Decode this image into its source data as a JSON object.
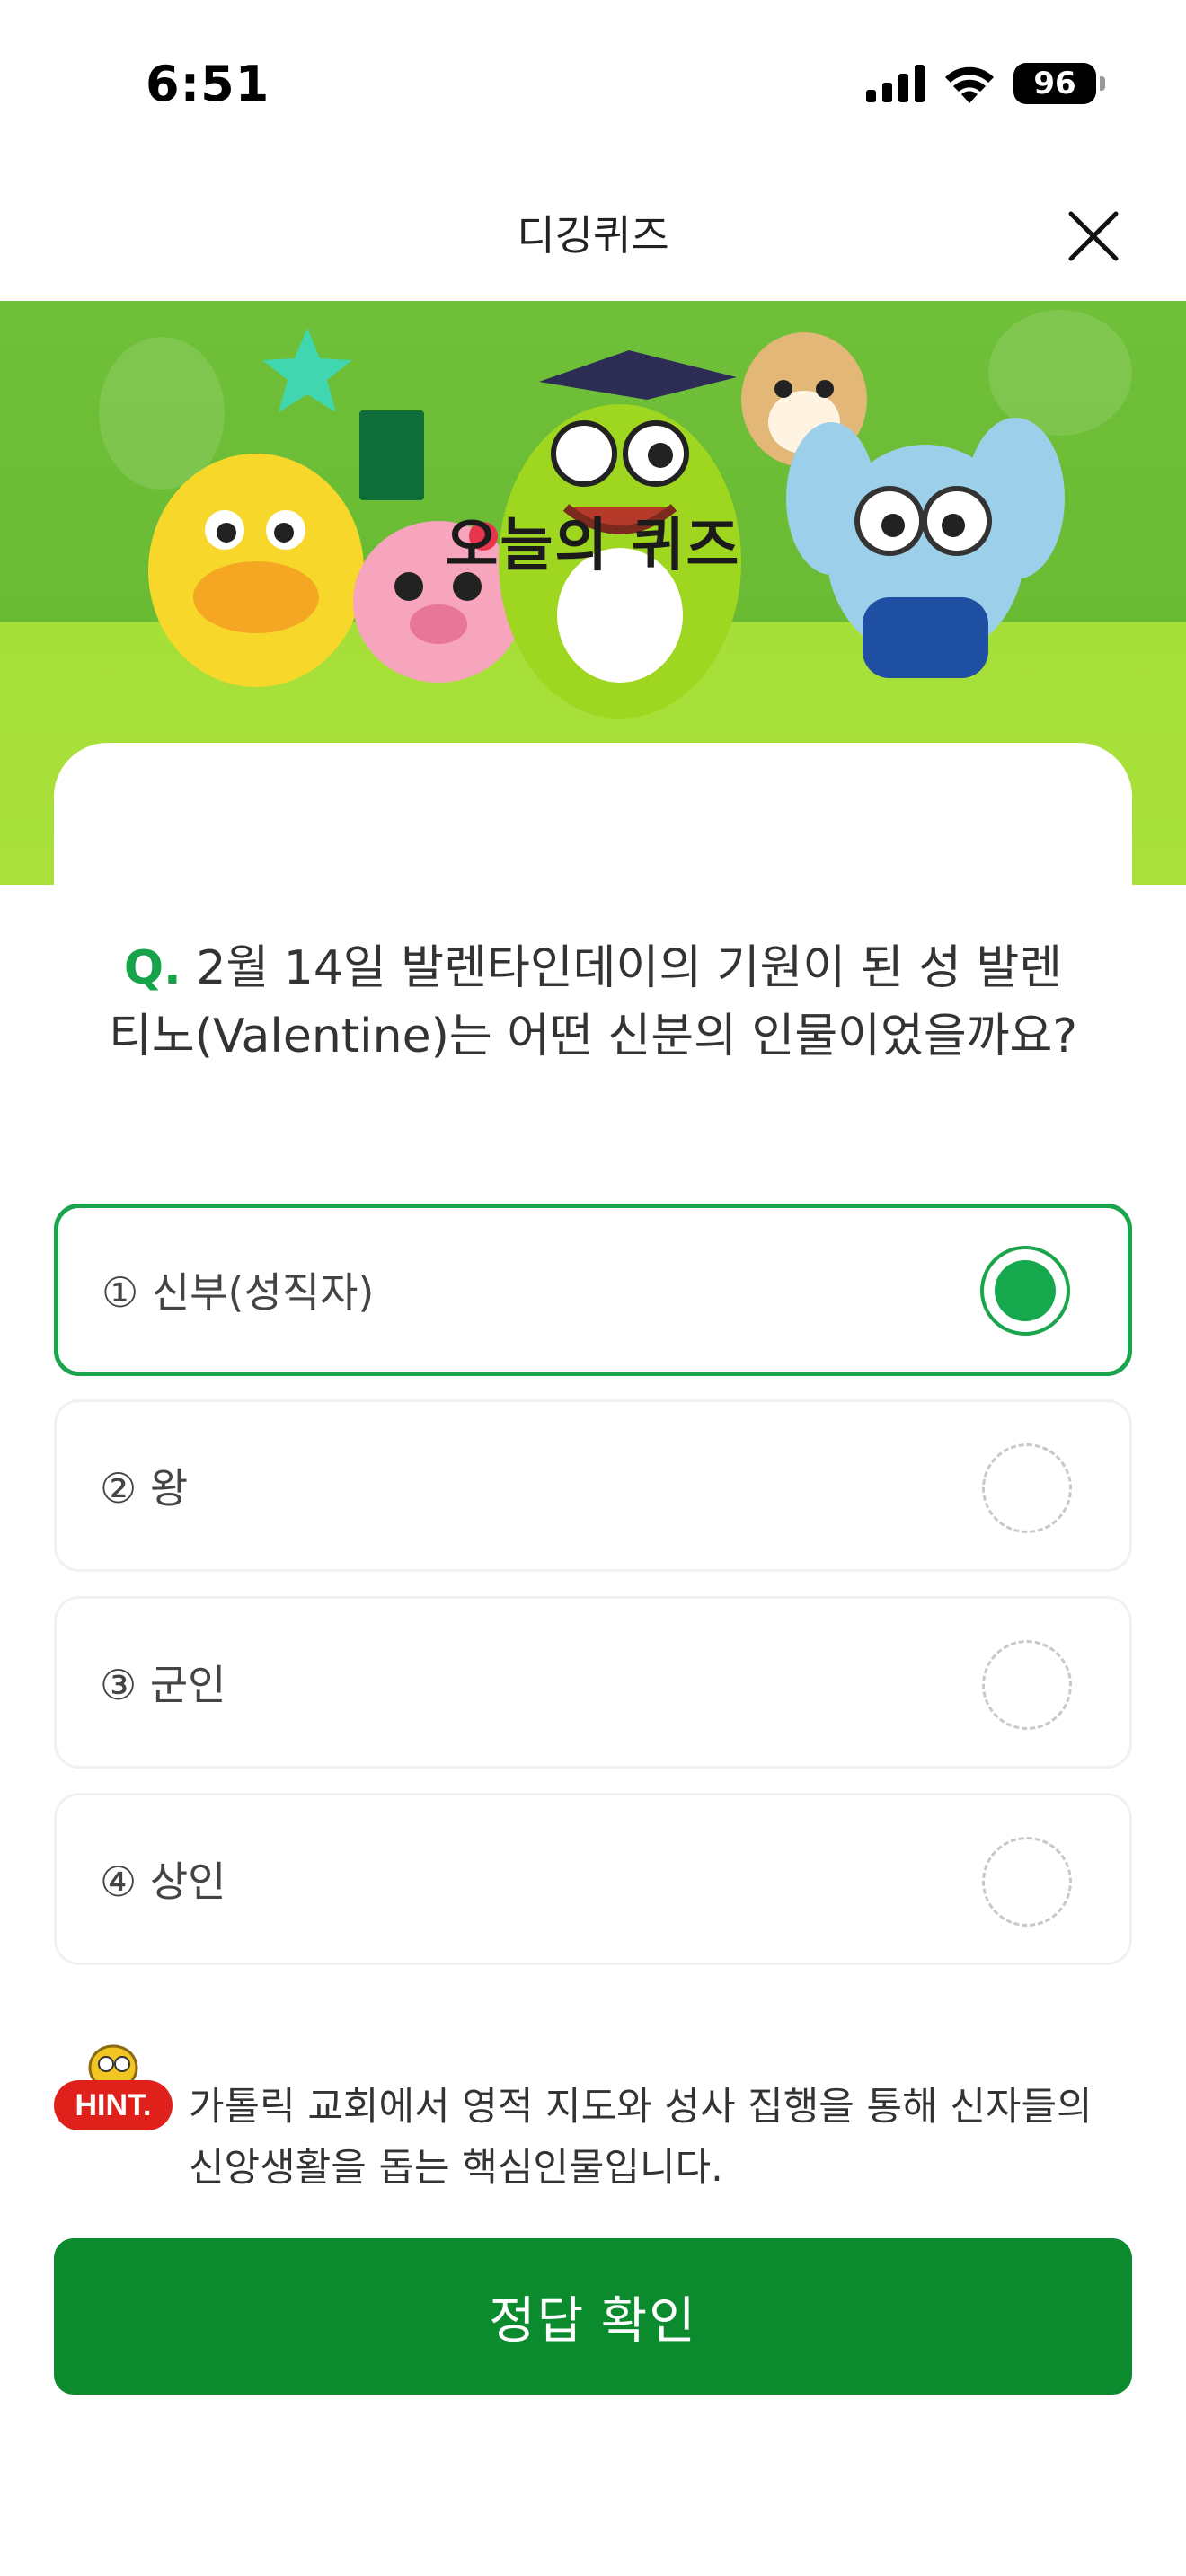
{
  "status_bar": {
    "time": "6:51",
    "battery": "96"
  },
  "header": {
    "title": "디깅퀴즈"
  },
  "banner": {
    "card_title": "오늘의 퀴즈"
  },
  "question": {
    "mark": "Q.",
    "text": "2월 14일 발렌타인데이의 기원이 된 성 발렌티노(Valentine)는 어떤 신분의 인물이었을까요?"
  },
  "options": [
    {
      "label": "① 신부(성직자)",
      "selected": true
    },
    {
      "label": "② 왕",
      "selected": false
    },
    {
      "label": "③ 군인",
      "selected": false
    },
    {
      "label": "④ 상인",
      "selected": false
    }
  ],
  "hint": {
    "badge": "HINT.",
    "text": "가톨릭 교회에서 영적 지도와 성사 집행을 통해 신자들의 신앙생활을 돕는 핵심인물입니다."
  },
  "submit_label": "정답 확인",
  "colors": {
    "accent": "#1aa54c",
    "button": "#0b8a2e",
    "banner_green": "#6fc038",
    "hint_red": "#e0201b"
  }
}
